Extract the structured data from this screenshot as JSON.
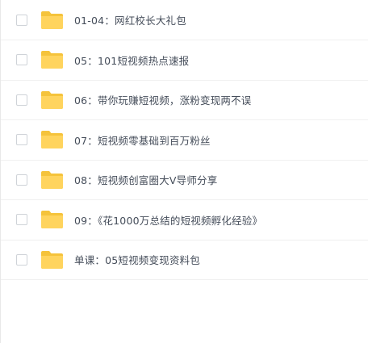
{
  "file_list": {
    "items": [
      {
        "name": "01-04：网红校长大礼包",
        "icon": "folder-icon"
      },
      {
        "name": "05：101短视频热点速报",
        "icon": "folder-icon"
      },
      {
        "name": "06：带你玩赚短视频，涨粉变现两不误",
        "icon": "folder-icon"
      },
      {
        "name": "07：短视频零基础到百万粉丝",
        "icon": "folder-icon"
      },
      {
        "name": "08：短视频创富圈大V导师分享",
        "icon": "folder-icon"
      },
      {
        "name": "09：《花1000万总结的短视频孵化经验》",
        "icon": "folder-icon"
      },
      {
        "name": "单课：05短视频变现资料包",
        "icon": "folder-icon"
      }
    ]
  },
  "colors": {
    "folder_fill": "#ffd45e",
    "folder_tab": "#f5c33b",
    "text": "#454d5a",
    "row_border": "#f0f0f0",
    "checkbox_border": "#cfd3d8"
  }
}
